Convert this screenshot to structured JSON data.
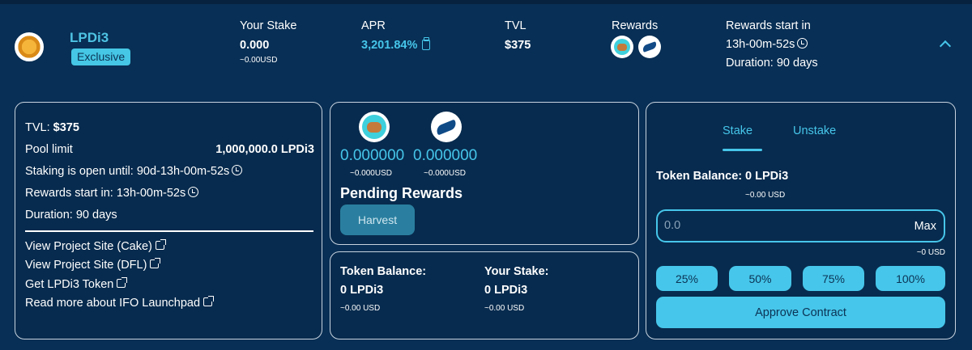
{
  "pool": {
    "name": "LPDi3",
    "badge": "Exclusive"
  },
  "header": {
    "your_stake_label": "Your Stake",
    "your_stake_value": "0.000",
    "your_stake_usd": "~0.00USD",
    "apr_label": "APR",
    "apr_value": "3,201.84%",
    "tvl_label": "TVL",
    "tvl_value": "$375",
    "rewards_label": "Rewards",
    "rewards_start_label": "Rewards start in",
    "rewards_start_value": "13h-00m-52s",
    "duration": "Duration: 90 days",
    "reward_tokens": [
      "cake-token-icon",
      "dfl-token-icon"
    ]
  },
  "info_panel": {
    "tvl_label": "TVL:",
    "tvl_value": "$375",
    "pool_limit_label": "Pool limit",
    "pool_limit_value": "1,000,000.0 LPDi3",
    "staking_open": "Staking is open until: 90d-13h-00m-52s",
    "rewards_start": "Rewards start in: 13h-00m-52s",
    "duration": "Duration: 90 days",
    "links": [
      "View Project Site (Cake)",
      "View Project Site (DFL)",
      "Get LPDi3 Token",
      "Read more about IFO Launchpad"
    ]
  },
  "rewards_panel": {
    "rewards": [
      {
        "token_icon": "cake-token-icon",
        "amount": "0.000000",
        "usd": "~0.000USD"
      },
      {
        "token_icon": "dfl-token-icon",
        "amount": "0.000000",
        "usd": "~0.000USD"
      }
    ],
    "title": "Pending Rewards",
    "harvest_label": "Harvest"
  },
  "balance_panel": {
    "token_balance_label": "Token Balance:",
    "token_balance_value": "0 LPDi3",
    "token_balance_usd": "~0.00 USD",
    "your_stake_label": "Your Stake:",
    "your_stake_value": "0 LPDi3",
    "your_stake_usd": "~0.00 USD"
  },
  "stake_panel": {
    "tabs": [
      "Stake",
      "Unstake"
    ],
    "active_tab": "Stake",
    "token_balance_label": "Token Balance:",
    "token_balance_value": "0 LPDi3",
    "token_balance_usd": "~0.00 USD",
    "input_placeholder": "0.0",
    "max_label": "Max",
    "input_usd": "~0 USD",
    "percent_buttons": [
      "25%",
      "50%",
      "75%",
      "100%"
    ],
    "approve_label": "Approve Contract"
  },
  "colors": {
    "background": "#082f55",
    "accent": "#46c6ea",
    "border": "#c8d3df"
  }
}
